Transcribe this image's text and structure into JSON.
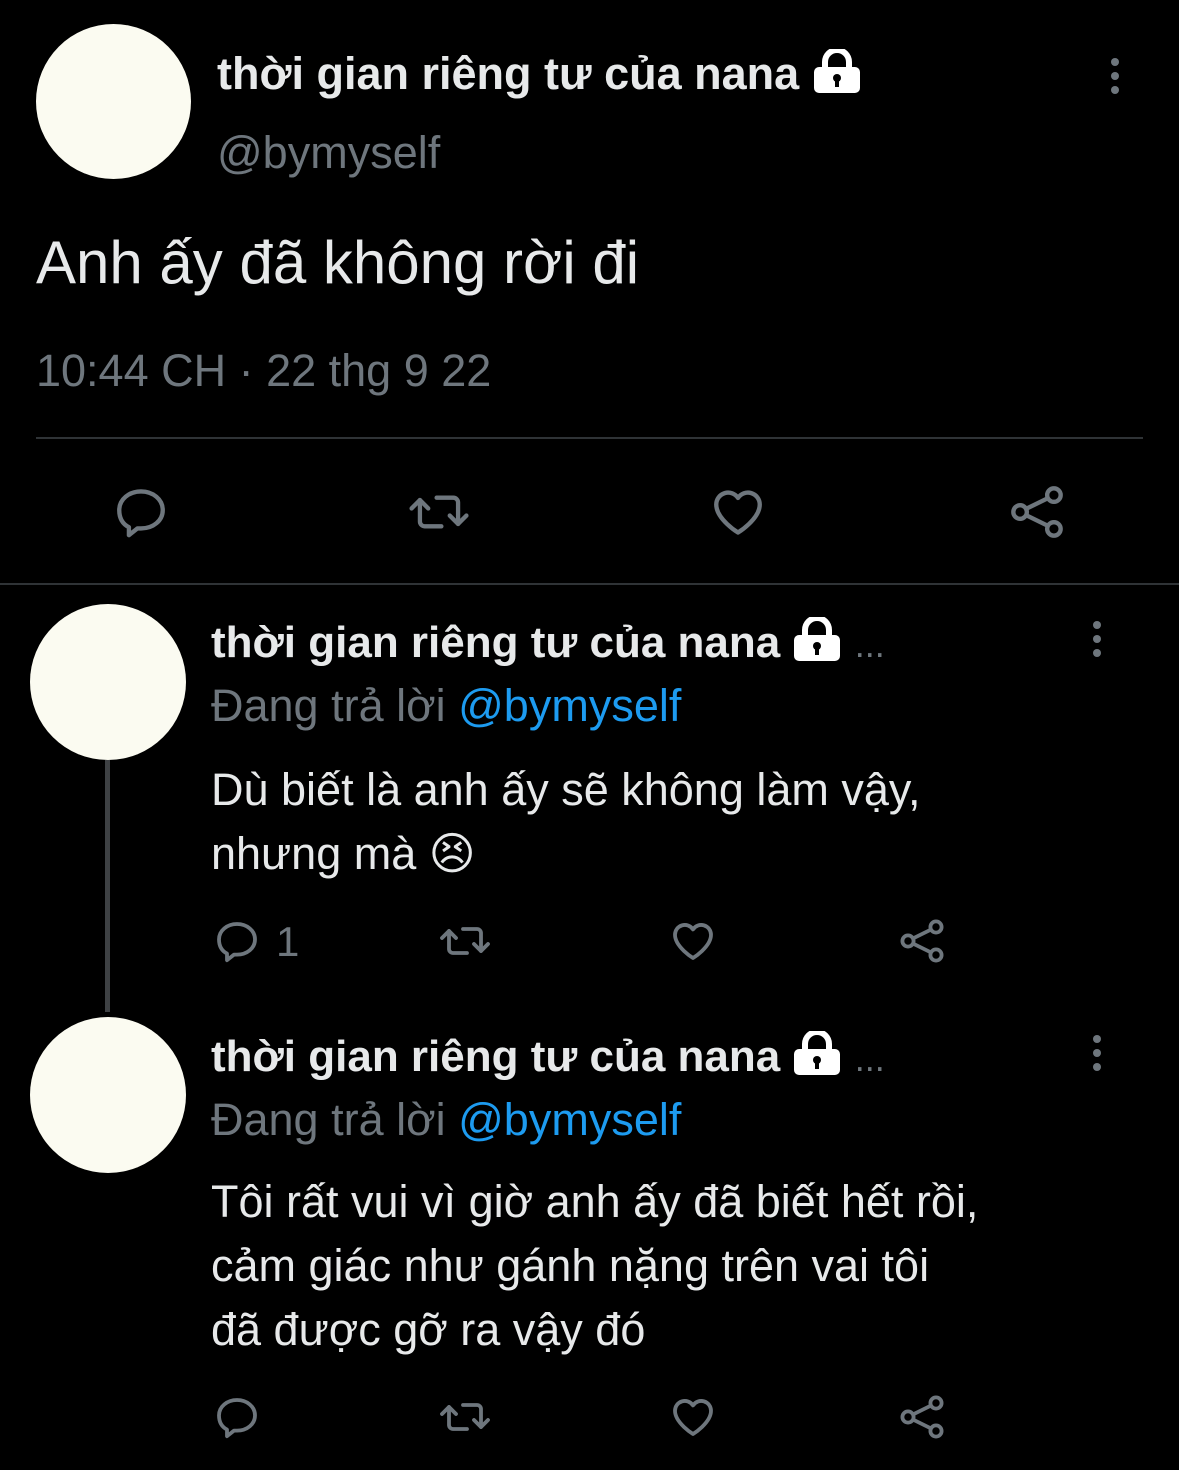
{
  "main_tweet": {
    "display_name": "thời gian riêng tư của nana",
    "handle": "@bymyself",
    "text": "Anh ấy đã không rời đi",
    "timestamp": "10:44 CH · 22 thg 9 22",
    "icons": [
      "lock-icon",
      "more-icon",
      "reply-icon",
      "retweet-icon",
      "like-icon",
      "share-icon"
    ]
  },
  "replies": [
    {
      "display_name": "thời gian riêng tư của nana",
      "ellipsis": "...",
      "replying_prefix": "Đang trả lời",
      "replying_to": "@bymyself",
      "line1": "Dù biết là anh ấy sẽ không làm vậy,",
      "line2": "nhưng mà",
      "emoji": "😣",
      "reply_count": "1"
    },
    {
      "display_name": "thời gian riêng tư của nana",
      "ellipsis": "...",
      "replying_prefix": "Đang trả lời",
      "replying_to": "@bymyself",
      "line1": "Tôi rất vui vì giờ anh ấy đã biết hết rồi,",
      "line2": "cảm giác như gánh nặng trên vai tôi",
      "line3": "đã được gỡ ra vậy đó",
      "reply_count": ""
    }
  ],
  "colors": {
    "background": "#000000",
    "text": "#e7e9ea",
    "muted": "#6e767d",
    "link": "#1d9bf0",
    "divider": "#2f3336"
  }
}
